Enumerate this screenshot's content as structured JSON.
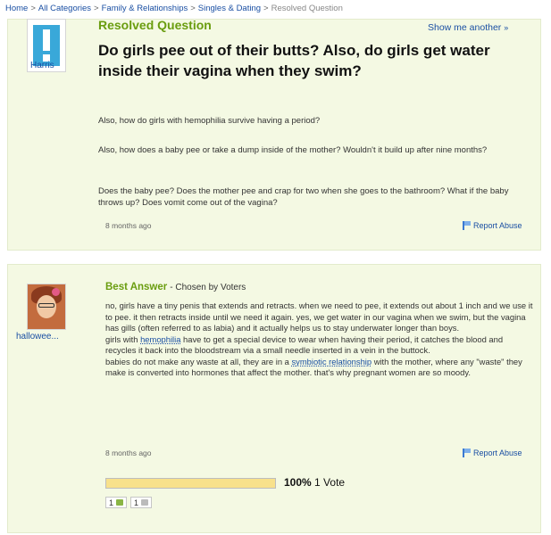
{
  "breadcrumb": {
    "items": [
      "Home",
      "All Categories",
      "Family & Relationships",
      "Singles & Dating"
    ],
    "current": "Resolved Question"
  },
  "question": {
    "status": "Resolved Question",
    "show_another": "Show me another",
    "show_another_arrow": "»",
    "asker": "Harris",
    "title": "Do girls pee out of their butts? Also, do girls get water inside their vagina when they swim?",
    "body": [
      "Also, how do girls with hemophilia survive having a period?",
      "Also, how does a baby pee or take a dump inside of the mother? Wouldn't it build up after nine months?",
      "Does the baby pee? Does the mother pee and crap for two when she goes to the bathroom? What if the baby throws up? Does vomit come out of the vagina?"
    ],
    "timestamp": "8 months ago",
    "report": "Report Abuse"
  },
  "answer": {
    "label": "Best Answer",
    "chosen": "- Chosen by Voters",
    "answerer": "hallowee...",
    "p1": "no, girls have a tiny penis that extends and retracts. when we need to pee, it extends out about 1 inch and we use it to pee. it then retracts inside until we need it again. yes, we get water in our vagina when we swim, but the vagina has gills (often referred to as labia) and it actually helps us to stay underwater longer than boys.",
    "p2a": "girls with ",
    "p2link": "hemophilia",
    "p2b": " have to get a special device to wear when having their period, it catches the blood and recycles it back into the bloodstream via a small needle inserted in a vein in the buttock.",
    "p3a": "babies do not make any waste at all, they are in a ",
    "p3link": "symbiotic relationship",
    "p3b": " with the mother, where any \"waste\" they make is converted into hormones that affect the mother. that's why pregnant women are so moody.",
    "timestamp": "8 months ago",
    "report": "Report Abuse"
  },
  "votes": {
    "percent_label": "100%",
    "votes_label": "1 Vote",
    "fill_fraction": 1.0,
    "thumbs_up": "1",
    "thumbs_down": "1"
  },
  "colors": {
    "accent_green": "#6a9d0f",
    "link_blue": "#1a4fa3",
    "panel_bg": "#f4f9e3",
    "vote_fill": "#f8e18b"
  },
  "icons": [
    "exclamation-avatar-icon",
    "flag-icon",
    "thumbs-up-icon",
    "thumbs-down-icon"
  ]
}
